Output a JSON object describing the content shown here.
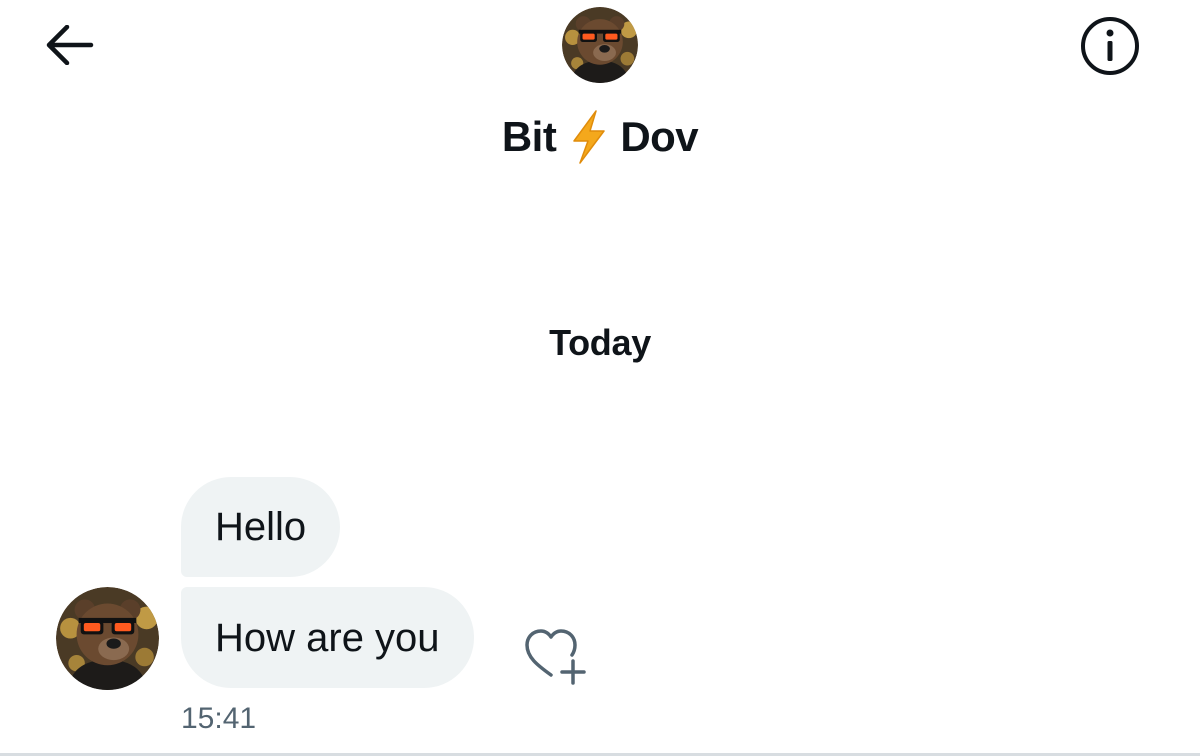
{
  "header": {
    "back_icon": "arrow-left-icon",
    "info_icon": "info-circle-icon",
    "avatar_icon": "bear-with-sunglasses-avatar",
    "name_part1": "Bit",
    "name_emoji_icon": "lightning-bolt-icon",
    "name_part2": "Dov"
  },
  "conversation": {
    "day_separator": "Today",
    "messages": [
      {
        "text": "Hello"
      },
      {
        "text": "How are you"
      }
    ],
    "react_icon": "heart-plus-icon",
    "sender_avatar_icon": "bear-with-sunglasses-avatar",
    "timestamp": "15:41"
  },
  "colors": {
    "bubble_bg": "#eff3f4",
    "text": "#0f1419",
    "muted_text": "#536471",
    "bolt": "#f4a81c"
  }
}
